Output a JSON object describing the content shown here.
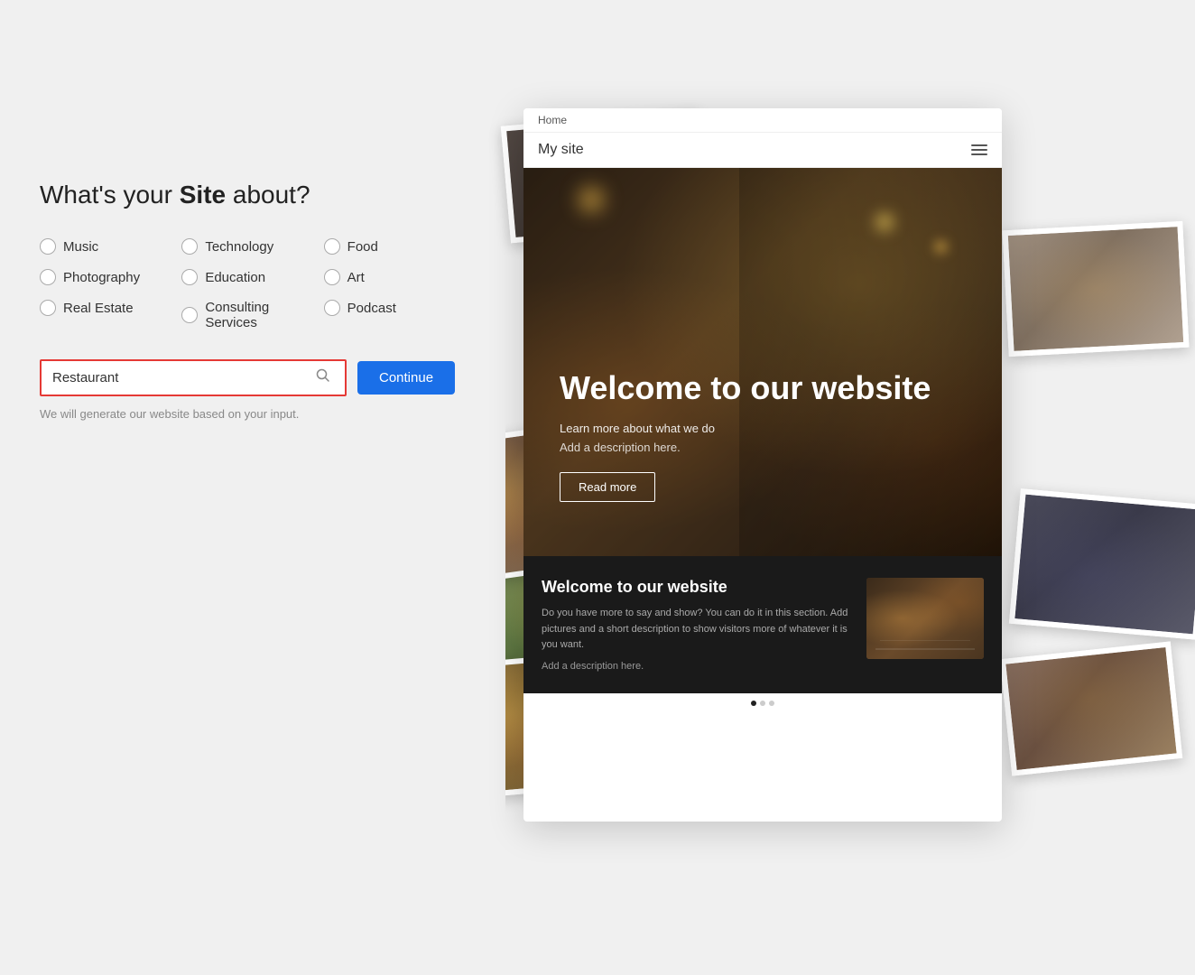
{
  "page": {
    "title": "What's your Site about?",
    "title_prefix": "What's your ",
    "title_bold": "Site",
    "title_suffix": " about?"
  },
  "options": {
    "col1": [
      {
        "label": "Music",
        "id": "music"
      },
      {
        "label": "Photography",
        "id": "photography"
      },
      {
        "label": "Real Estate",
        "id": "real-estate"
      }
    ],
    "col2": [
      {
        "label": "Technology",
        "id": "technology"
      },
      {
        "label": "Education",
        "id": "education"
      },
      {
        "label": "Consulting Services",
        "id": "consulting"
      }
    ],
    "col3": [
      {
        "label": "Food",
        "id": "food"
      },
      {
        "label": "Art",
        "id": "art"
      },
      {
        "label": "Podcast",
        "id": "podcast"
      }
    ]
  },
  "search": {
    "value": "Restaurant",
    "placeholder": "Restaurant",
    "search_icon": "🔍"
  },
  "buttons": {
    "continue": "Continue"
  },
  "helper": {
    "text": "We will generate our website based on your input."
  },
  "preview": {
    "browser_tab": "Home",
    "site_title": "My site",
    "hero": {
      "title": "Welcome to our website",
      "subtitle": "Learn more about what we do",
      "description": "Add a description here.",
      "cta": "Read more"
    },
    "bottom_section": {
      "title": "Welcome to our website",
      "body": "Do you have more to say and show? You can do it in this section. Add pictures and a short description to show visitors more of whatever it is you want.",
      "add_desc": "Add a description here."
    }
  }
}
